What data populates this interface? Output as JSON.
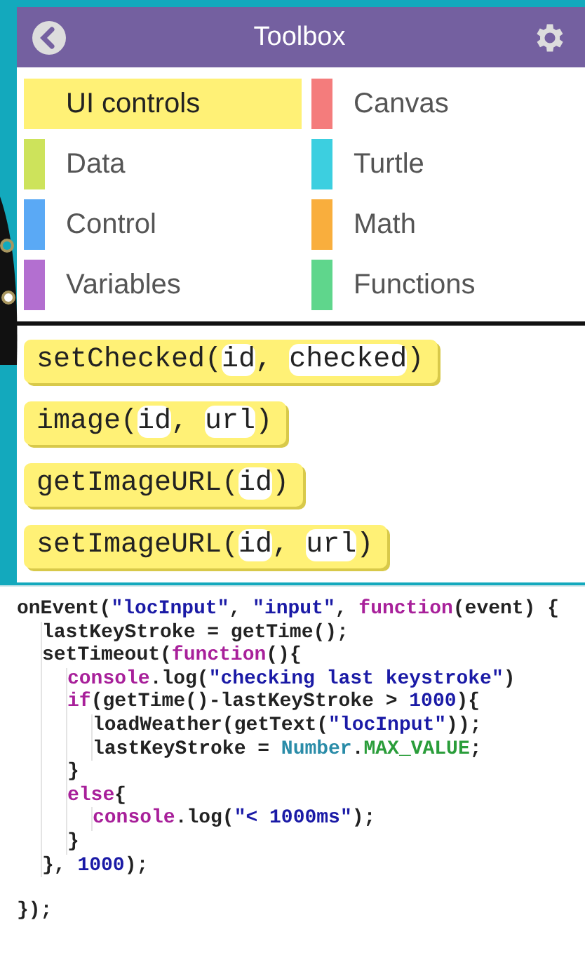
{
  "header": {
    "title": "Toolbox"
  },
  "categories": [
    {
      "label": "UI controls",
      "color": "#fff176",
      "selected": true
    },
    {
      "label": "Canvas",
      "color": "#f47c7c",
      "selected": false
    },
    {
      "label": "Data",
      "color": "#cde35b",
      "selected": false
    },
    {
      "label": "Turtle",
      "color": "#3ccfe0",
      "selected": false
    },
    {
      "label": "Control",
      "color": "#5aa9f5",
      "selected": false
    },
    {
      "label": "Math",
      "color": "#f9ae3d",
      "selected": false
    },
    {
      "label": "Variables",
      "color": "#b36fd0",
      "selected": false
    },
    {
      "label": "Functions",
      "color": "#5fd68c",
      "selected": false
    }
  ],
  "blocks": [
    {
      "parts": [
        {
          "kind": "text",
          "text": "setChecked("
        },
        {
          "kind": "param",
          "text": "id"
        },
        {
          "kind": "text",
          "text": ", "
        },
        {
          "kind": "param",
          "text": "checked"
        },
        {
          "kind": "text",
          "text": ")"
        }
      ]
    },
    {
      "parts": [
        {
          "kind": "text",
          "text": "image("
        },
        {
          "kind": "param",
          "text": "id"
        },
        {
          "kind": "text",
          "text": ", "
        },
        {
          "kind": "param",
          "text": "url"
        },
        {
          "kind": "text",
          "text": ")"
        }
      ]
    },
    {
      "parts": [
        {
          "kind": "text",
          "text": "getImageURL("
        },
        {
          "kind": "param",
          "text": "id"
        },
        {
          "kind": "text",
          "text": ")"
        }
      ]
    },
    {
      "parts": [
        {
          "kind": "text",
          "text": "setImageURL("
        },
        {
          "kind": "param",
          "text": "id"
        },
        {
          "kind": "text",
          "text": ", "
        },
        {
          "kind": "param",
          "text": "url"
        },
        {
          "kind": "text",
          "text": ")"
        }
      ]
    }
  ],
  "code": [
    {
      "tokens": [
        {
          "kind": "plain",
          "text": "onEvent("
        },
        {
          "kind": "string",
          "text": "\"locInput\""
        },
        {
          "kind": "plain",
          "text": ", "
        },
        {
          "kind": "string",
          "text": "\"input\""
        },
        {
          "kind": "plain",
          "text": ", "
        },
        {
          "kind": "keyword",
          "text": "function"
        },
        {
          "kind": "plain",
          "text": "(event) {"
        }
      ],
      "children": [
        {
          "tokens": [
            {
              "kind": "plain",
              "text": "lastKeyStroke = getTime();"
            }
          ]
        },
        {
          "tokens": [
            {
              "kind": "plain",
              "text": "setTimeout("
            },
            {
              "kind": "keyword",
              "text": "function"
            },
            {
              "kind": "plain",
              "text": "(){"
            }
          ],
          "children": [
            {
              "tokens": [
                {
                  "kind": "keyword",
                  "text": "console"
                },
                {
                  "kind": "plain",
                  "text": ".log("
                },
                {
                  "kind": "string",
                  "text": "\"checking last keystroke\""
                },
                {
                  "kind": "plain",
                  "text": ")"
                }
              ]
            },
            {
              "tokens": [
                {
                  "kind": "keyword",
                  "text": "if"
                },
                {
                  "kind": "plain",
                  "text": "(getTime()-lastKeyStroke > "
                },
                {
                  "kind": "number",
                  "text": "1000"
                },
                {
                  "kind": "plain",
                  "text": "){"
                }
              ],
              "children": [
                {
                  "tokens": [
                    {
                      "kind": "plain",
                      "text": "loadWeather(getText("
                    },
                    {
                      "kind": "string",
                      "text": "\"locInput\""
                    },
                    {
                      "kind": "plain",
                      "text": "));"
                    }
                  ]
                },
                {
                  "tokens": [
                    {
                      "kind": "plain",
                      "text": "lastKeyStroke = "
                    },
                    {
                      "kind": "object",
                      "text": "Number"
                    },
                    {
                      "kind": "plain",
                      "text": "."
                    },
                    {
                      "kind": "property",
                      "text": "MAX_VALUE"
                    },
                    {
                      "kind": "plain",
                      "text": ";"
                    }
                  ]
                }
              ]
            },
            {
              "tokens": [
                {
                  "kind": "plain",
                  "text": "}"
                }
              ]
            },
            {
              "tokens": [
                {
                  "kind": "keyword",
                  "text": "else"
                },
                {
                  "kind": "plain",
                  "text": "{"
                }
              ],
              "children": [
                {
                  "tokens": [
                    {
                      "kind": "keyword",
                      "text": "console"
                    },
                    {
                      "kind": "plain",
                      "text": ".log("
                    },
                    {
                      "kind": "string",
                      "text": "\"< 1000ms\""
                    },
                    {
                      "kind": "plain",
                      "text": ");"
                    }
                  ]
                }
              ]
            },
            {
              "tokens": [
                {
                  "kind": "plain",
                  "text": "}"
                }
              ]
            }
          ]
        },
        {
          "tokens": [
            {
              "kind": "plain",
              "text": "}, "
            },
            {
              "kind": "number",
              "text": "1000"
            },
            {
              "kind": "plain",
              "text": ");"
            }
          ]
        }
      ]
    },
    {
      "tokens": [
        {
          "kind": "plain",
          "text": "});"
        }
      ]
    }
  ]
}
